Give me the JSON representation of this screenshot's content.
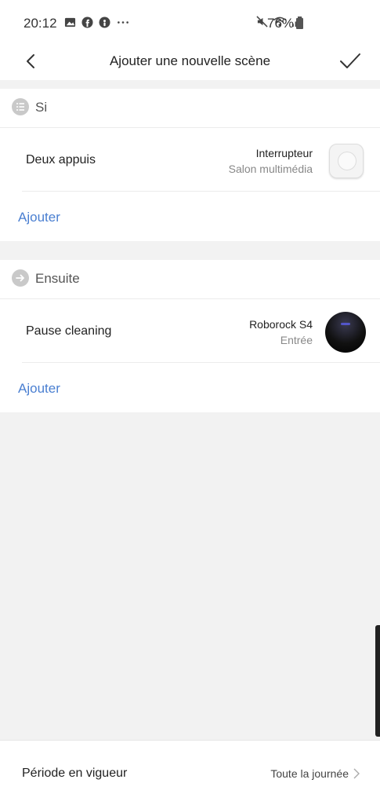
{
  "status_bar": {
    "time": "20:12",
    "battery": "76%",
    "icons": [
      "image-icon",
      "facebook-icon",
      "messenger-icon",
      "more-dots-icon",
      "mute-icon",
      "wifi-icon",
      "signal-icon",
      "battery-icon"
    ]
  },
  "header": {
    "title": "Ajouter une nouvelle scène"
  },
  "sections": [
    {
      "label": "Si",
      "row": {
        "title": "Deux appuis",
        "device": "Interrupteur",
        "room": "Salon multimédia"
      },
      "add_label": "Ajouter"
    },
    {
      "label": "Ensuite",
      "row": {
        "title": "Pause cleaning",
        "device": "Roborock S4",
        "room": "Entrée"
      },
      "add_label": "Ajouter"
    }
  ],
  "footer": {
    "label": "Période en vigueur",
    "value": "Toute la journée"
  },
  "colors": {
    "accent": "#4a7fd1",
    "background": "#f2f2f2"
  }
}
